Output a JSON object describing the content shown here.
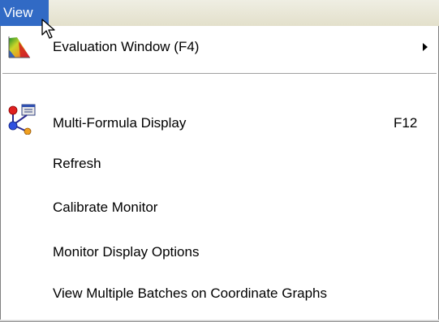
{
  "menubar": {
    "title": "View"
  },
  "menu": {
    "items": [
      {
        "label": "Evaluation Window (F4)",
        "icon": "evaluation-window-icon",
        "has_submenu": true
      },
      {
        "label": "Multi-Formula Display",
        "shortcut": "F12",
        "icon": "multi-formula-display-icon"
      },
      {
        "label": "Refresh"
      },
      {
        "label": "Calibrate Monitor"
      },
      {
        "label": "Monitor Display Options"
      },
      {
        "label": "View Multiple Batches on Coordinate Graphs"
      }
    ]
  }
}
